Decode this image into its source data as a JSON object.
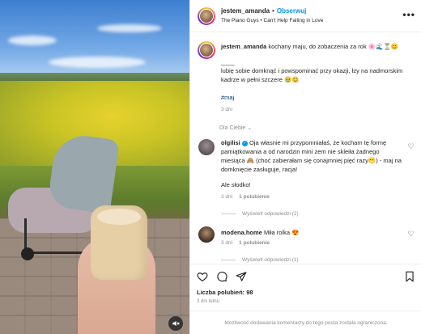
{
  "header": {
    "username": "jestem_amanda",
    "follow_label": "Obserwuj",
    "song": "The Piano Guys • Can't Help Falling in Love",
    "more": "•••"
  },
  "caption": {
    "username": "jestem_amanda",
    "line1": "kochany maju, do zobaczenia za rok 🌸🌊⏳😊",
    "separator": "____",
    "body": "lubię sobie domknąć i powspominać przy okazji, łzy na nadmorskim kadrze w pełni szczere 🥹😊",
    "hashtag": "#maj",
    "time": "3 dni"
  },
  "for_you_label": "Dla Ciebie",
  "comments": [
    {
      "username": "olgilisi",
      "text": "Oja własnie mi przypomniałaś, że kocham tę formę pamiątkowania a od narodzin mini zem nie skleiła żadnego miesiąca 🙈 (choć zabierałam się conajmniej pięć razy😬) - maj na domknięcie zasługuje, racja!",
      "text2": "Ale słodko!",
      "time": "3 dni",
      "likes": "1 polubienie",
      "replies": "Wyświetl odpowiedzi (2)"
    },
    {
      "username": "modena.home",
      "text": "Miła rolka 😍",
      "time": "3 dni",
      "likes": "1 polubienie",
      "replies": "Wyświetl odpowiedzi (1)"
    }
  ],
  "likes_label": "Liczba polubień:",
  "likes_count": "98",
  "posted_ago": "3 dni temu",
  "footer_text": "Możliwość dodawania komentarzy do tego posta została ograniczona.",
  "colors": {
    "accent": "#0095f6",
    "muted": "#8e8e8e",
    "text": "#262626"
  }
}
